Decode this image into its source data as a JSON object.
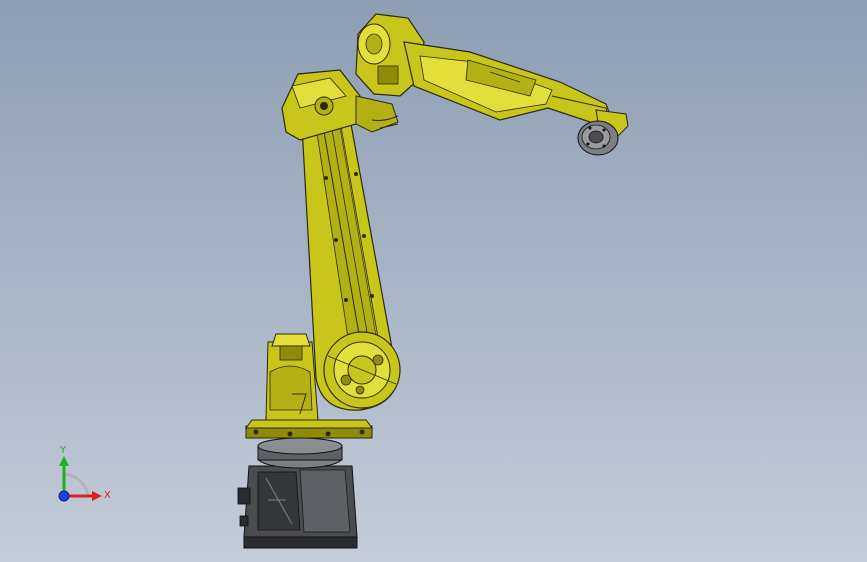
{
  "scene": {
    "model_description": "",
    "colors": {
      "background_top": "#8f9eb4",
      "background_bottom": "#c3ccd8",
      "robot_body": "#c8c61a",
      "robot_body_dark": "#8f8c0a",
      "robot_body_light": "#e2df3a",
      "outline": "#2a2a10",
      "base": "#4a4c50",
      "base_dark": "#2b2c2f",
      "base_light": "#7c7f84",
      "flange": "#9a9ca0"
    }
  },
  "triad": {
    "x_label": "X",
    "y_label": "Y",
    "x_color": "#e02020",
    "y_color": "#20b020",
    "z_color": "#2040e0"
  }
}
